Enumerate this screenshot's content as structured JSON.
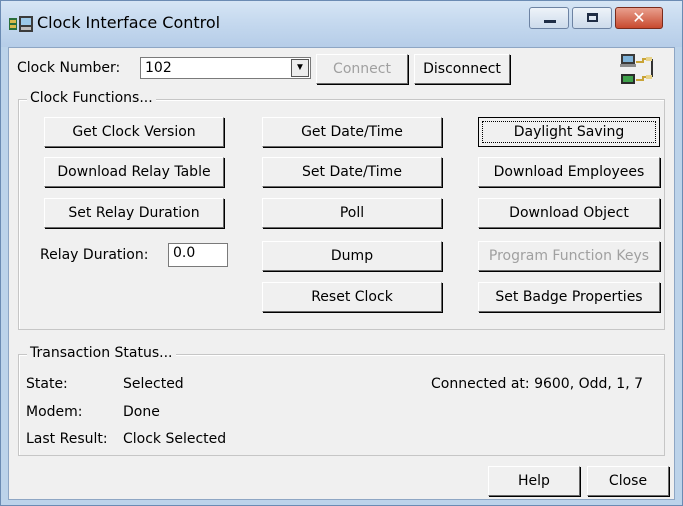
{
  "window": {
    "title": "Clock Interface Control",
    "close_glyph": "✕"
  },
  "clock_number": {
    "label": "Clock Number:",
    "value": "102"
  },
  "toolbar": {
    "connect_label": "Connect",
    "disconnect_label": "Disconnect"
  },
  "clock_functions": {
    "title": "Clock Functions...",
    "get_clock_version": "Get Clock Version",
    "download_relay_table": "Download Relay Table",
    "set_relay_duration": "Set Relay Duration",
    "relay_duration_label": "Relay Duration:",
    "relay_duration_value": "0.0",
    "get_date_time": "Get Date/Time",
    "set_date_time": "Set Date/Time",
    "poll": "Poll",
    "dump": "Dump",
    "reset_clock": "Reset Clock",
    "daylight_saving": "Daylight Saving",
    "download_employees": "Download Employees",
    "download_object": "Download Object",
    "program_function_keys": "Program Function Keys",
    "set_badge_properties": "Set Badge Properties"
  },
  "transaction_status": {
    "title": "Transaction Status...",
    "state_label": "State:",
    "state_value": "Selected",
    "modem_label": "Modem:",
    "modem_value": "Done",
    "last_result_label": "Last Result:",
    "last_result_value": "Clock Selected",
    "connected_at": "Connected at: 9600, Odd, 1, 7"
  },
  "footer": {
    "help_label": "Help",
    "close_label": "Close"
  }
}
